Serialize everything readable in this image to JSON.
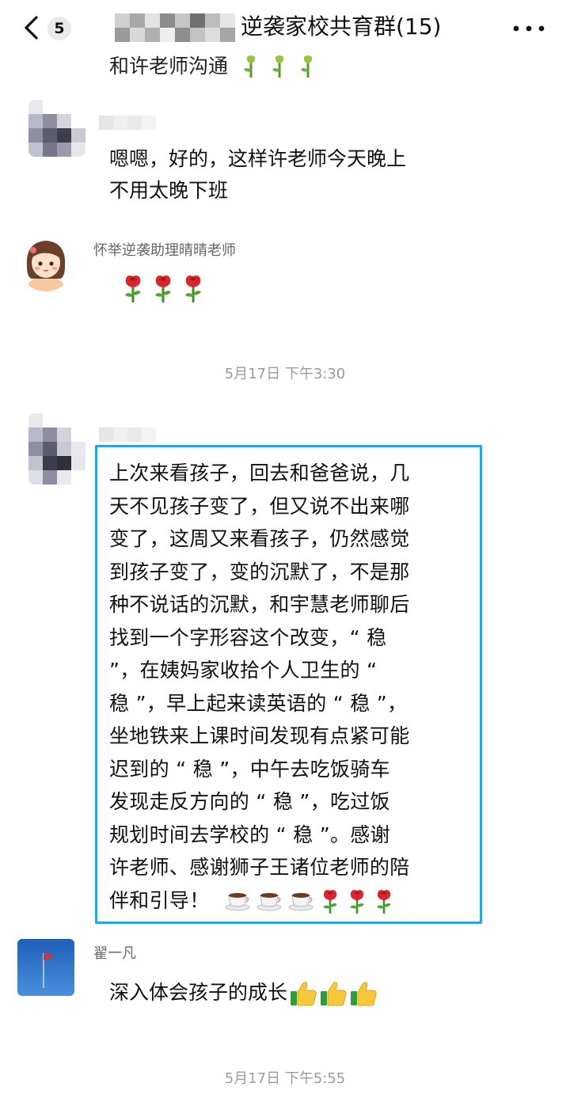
{
  "header": {
    "unread_count": "5",
    "group_title": "逆袭家校共育群(15)",
    "partial_top_message": "和许老师沟通",
    "blurred_colors": [
      "#cfcfcf",
      "#a8a8a8",
      "#e2e2e2",
      "#8c8c8c",
      "#c6c6c6",
      "#707070",
      "#bdbdbd",
      "#e6e6e6",
      "#9a9a9a",
      "#d8d8d8",
      "#b0b0b0",
      "#efefef",
      "#8e8e8e",
      "#c2c2c2",
      "#dcdcdc",
      "#a5a5a5"
    ]
  },
  "messages": [
    {
      "sender": "",
      "text_lines": [
        "嗯嗯，好的，这样许老师今天晚上",
        "不用太晚下班"
      ]
    },
    {
      "sender": "怀举逆袭助理晴晴老师",
      "emoji": [
        "rose",
        "rose",
        "rose"
      ]
    },
    {
      "timestamp": "5月17日 下午3:30"
    },
    {
      "sender": "",
      "text_lines": [
        "上次来看孩子，回去和爸爸说，几",
        "天不见孩子变了，但又说不出来哪",
        "变了，这周又来看孩子，仍然感觉",
        "到孩子变了，变的沉默了，不是那",
        "种不说话的沉默，和宇慧老师聊后",
        "找到一个字形容这个改变，“ 稳",
        "”，在姨妈家收拾个人卫生的 “",
        "稳 ”，早上起来读英语的 “ 稳 ”，",
        "坐地铁来上课时间发现有点紧可能",
        "迟到的 “ 稳 ”，中午去吃饭骑车",
        "发现走反方向的 “ 稳 ”，吃过饭",
        "规划时间去学校的 “ 稳 ”。感谢",
        "许老师、感谢狮子王诸位老师的陪",
        "伴和引导！"
      ],
      "emoji": [
        "coffee",
        "coffee",
        "coffee",
        "rose",
        "rose",
        "rose"
      ]
    },
    {
      "sender": "翟一凡",
      "text": "深入体会孩子的成长",
      "emoji": [
        "thumbs-up",
        "thumbs-up",
        "thumbs-up"
      ]
    },
    {
      "timestamp": "5月17日 下午5:55"
    }
  ],
  "colors": {
    "highlight_border": "#2aa4de",
    "timestamp": "#9a9a9a",
    "sender_name": "#666666",
    "rose": "#d8262d",
    "stem": "#4a9a2a"
  }
}
